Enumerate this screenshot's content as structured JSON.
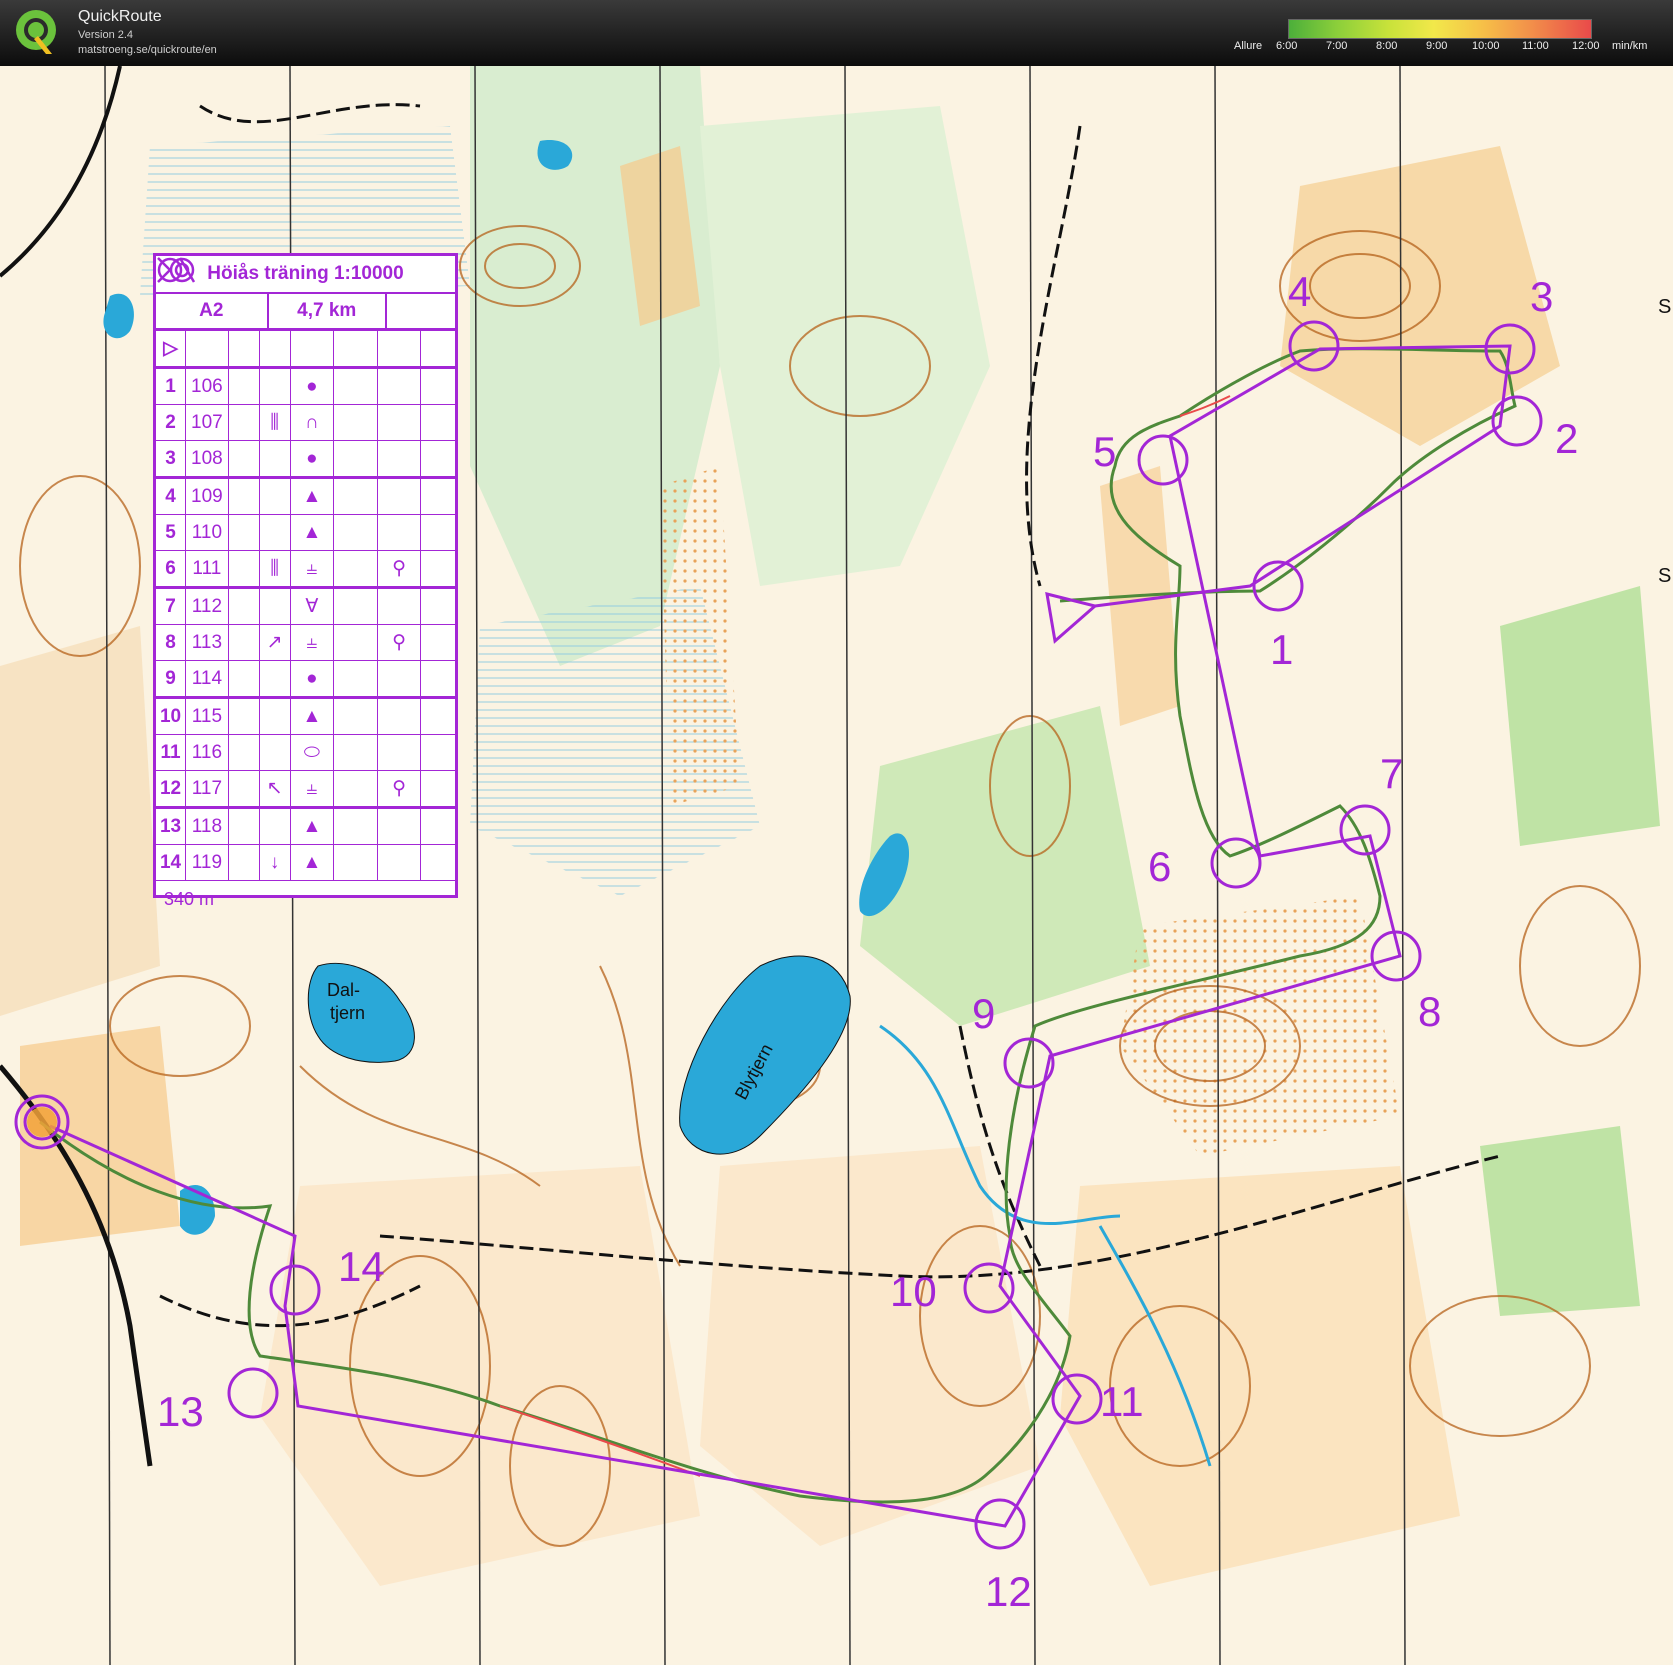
{
  "app": {
    "title": "QuickRoute",
    "version": "Version 2.4",
    "url": "matstroeng.se/quickroute/en",
    "logo_icon": "quickroute-logo-icon"
  },
  "pace_legend": {
    "label": "Allure",
    "ticks": [
      "6:00",
      "7:00",
      "8:00",
      "9:00",
      "10:00",
      "11:00",
      "12:00"
    ],
    "unit": "min/km",
    "colors": [
      "#4caf3a",
      "#c8e23a",
      "#f2e84a",
      "#f2904a",
      "#e94a4a"
    ]
  },
  "control_card": {
    "title": "Höiås träning 1:10000",
    "class": "A2",
    "length": "4,7 km",
    "start_symbol": "▷",
    "rows": [
      {
        "num": "",
        "code": "",
        "sym1": "",
        "sym2": "",
        "start": true
      },
      {
        "num": "1",
        "code": "106",
        "sym1": "",
        "sym2": "●",
        "extra": ""
      },
      {
        "num": "2",
        "code": "107",
        "sym1": "⫼",
        "sym2": "∩",
        "extra": ""
      },
      {
        "num": "3",
        "code": "108",
        "sym1": "",
        "sym2": "●",
        "extra": ""
      },
      {
        "num": "4",
        "code": "109",
        "sym1": "",
        "sym2": "▲",
        "extra": ""
      },
      {
        "num": "5",
        "code": "110",
        "sym1": "",
        "sym2": "▲",
        "extra": ""
      },
      {
        "num": "6",
        "code": "111",
        "sym1": "⫼",
        "sym2": "⫨",
        "extra": "⚲"
      },
      {
        "num": "7",
        "code": "112",
        "sym1": "",
        "sym2": "∀",
        "extra": ""
      },
      {
        "num": "8",
        "code": "113",
        "sym1": "↗",
        "sym2": "⫨",
        "extra": "⚲"
      },
      {
        "num": "9",
        "code": "114",
        "sym1": "",
        "sym2": "●",
        "extra": ""
      },
      {
        "num": "10",
        "code": "115",
        "sym1": "",
        "sym2": "▲",
        "extra": ""
      },
      {
        "num": "11",
        "code": "116",
        "sym1": "",
        "sym2": "⬭",
        "extra": ""
      },
      {
        "num": "12",
        "code": "117",
        "sym1": "↖",
        "sym2": "⫨",
        "extra": "⚲"
      },
      {
        "num": "13",
        "code": "118",
        "sym1": "",
        "sym2": "▲",
        "extra": ""
      },
      {
        "num": "14",
        "code": "119",
        "sym1": "↓",
        "sym2": "▲",
        "extra": ""
      }
    ],
    "finish_distance": "340 m"
  },
  "map": {
    "lakes": [
      "Dal-\ntjern",
      "Blytjern"
    ],
    "lake_label_1a": "Dal-",
    "lake_label_1b": "tjern",
    "lake_label_2": "Blytjern",
    "control_numbers": [
      "1",
      "2",
      "3",
      "4",
      "5",
      "6",
      "7",
      "8",
      "9",
      "10",
      "11",
      "12",
      "13",
      "14"
    ],
    "partial_edge_letters": [
      "S",
      "S"
    ],
    "course_color": "#a326d6",
    "route_color": "#4e8a3a",
    "water_color": "#2aa8d8",
    "vegetation_color": "#cfe9b8",
    "open_color": "#f7c98a",
    "contour_color": "#b5611a"
  }
}
